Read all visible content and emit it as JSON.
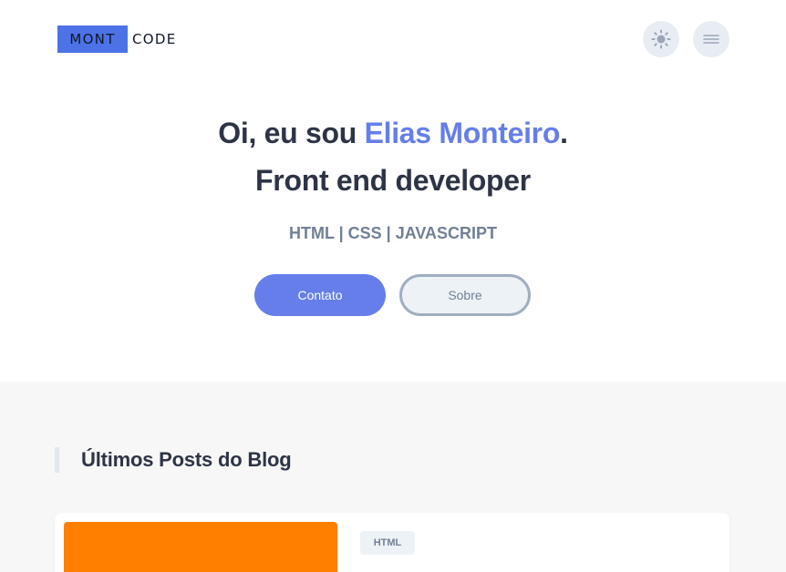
{
  "header": {
    "logo_part1": "MONT",
    "logo_part2": "CODE",
    "theme_icon": "sun-icon",
    "menu_icon": "hamburger-menu-icon"
  },
  "hero": {
    "greeting": "Oi, eu sou ",
    "name": "Elias Monteiro",
    "period": ".",
    "role": "Front end developer",
    "skills": "HTML | CSS | JAVASCRIPT",
    "primary_button": "Contato",
    "secondary_button": "Sobre"
  },
  "blog": {
    "title": "Últimos Posts do Blog",
    "posts": [
      {
        "tag": "HTML",
        "image_color": "#ff7f00"
      }
    ]
  },
  "colors": {
    "accent": "#667eea",
    "logo_bg": "#4c72e6",
    "heading": "#2d3446",
    "muted": "#718096",
    "section_bg": "#f7f7f7"
  }
}
